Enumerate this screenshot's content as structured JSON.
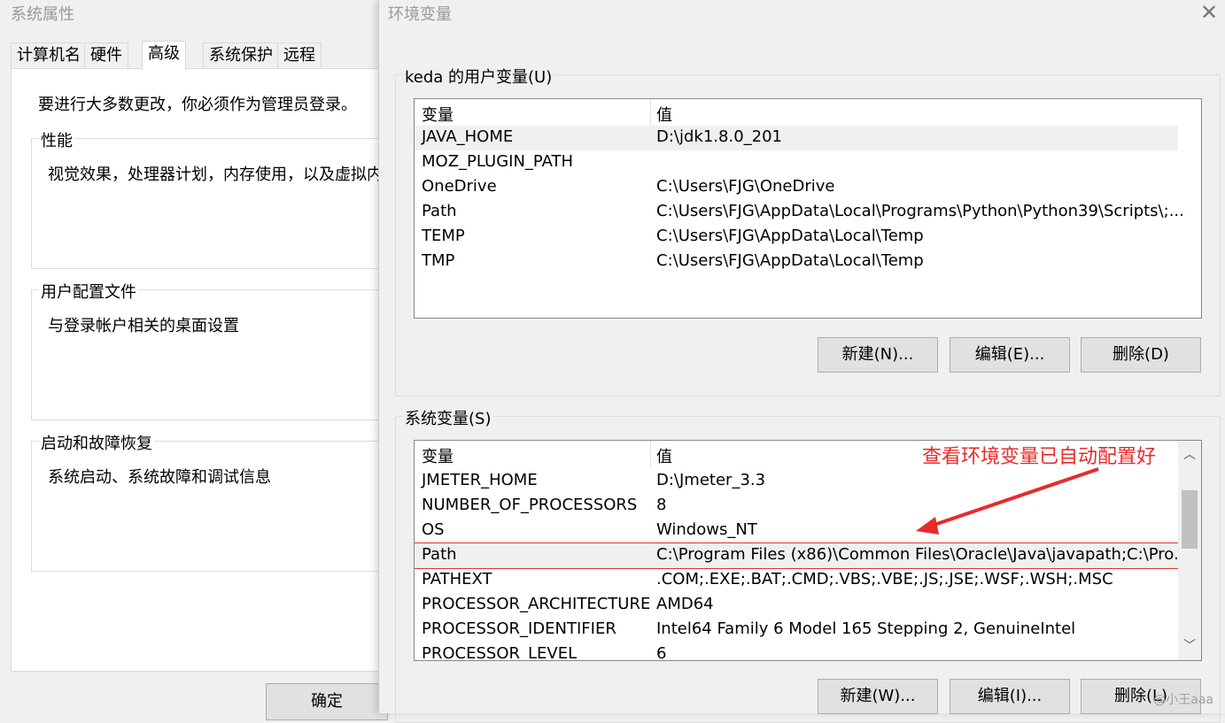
{
  "system_properties": {
    "title": "系统属性",
    "tabs": [
      "计算机名",
      "硬件",
      "高级",
      "系统保护",
      "远程"
    ],
    "active_tab": "高级",
    "admin_note": "要进行大多数更改，你必须作为管理员登录。",
    "groups": [
      {
        "label": "性能",
        "desc": "视觉效果，处理器计划，内存使用，以及虚拟内"
      },
      {
        "label": "用户配置文件",
        "desc": "与登录帐户相关的桌面设置"
      },
      {
        "label": "启动和故障恢复",
        "desc": "系统启动、系统故障和调试信息"
      }
    ],
    "ok_label": "确定"
  },
  "env_dialog": {
    "title": "环境变量",
    "close_icon": "close-icon",
    "user_vars": {
      "legend": "keda 的用户变量(U)",
      "col_var": "变量",
      "col_val": "值",
      "rows": [
        {
          "name": "JAVA_HOME",
          "value": "D:\\jdk1.8.0_201"
        },
        {
          "name": "MOZ_PLUGIN_PATH",
          "value": ""
        },
        {
          "name": "OneDrive",
          "value": "C:\\Users\\FJG\\OneDrive"
        },
        {
          "name": "Path",
          "value": "C:\\Users\\FJG\\AppData\\Local\\Programs\\Python\\Python39\\Scripts\\;..."
        },
        {
          "name": "TEMP",
          "value": "C:\\Users\\FJG\\AppData\\Local\\Temp"
        },
        {
          "name": "TMP",
          "value": "C:\\Users\\FJG\\AppData\\Local\\Temp"
        }
      ],
      "buttons": {
        "new": "新建(N)...",
        "edit": "编辑(E)...",
        "delete": "删除(D)"
      }
    },
    "sys_vars": {
      "legend": "系统变量(S)",
      "col_var": "变量",
      "col_val": "值",
      "rows": [
        {
          "name": "JMETER_HOME",
          "value": "D:\\Jmeter_3.3"
        },
        {
          "name": "NUMBER_OF_PROCESSORS",
          "value": "8"
        },
        {
          "name": "OS",
          "value": "Windows_NT"
        },
        {
          "name": "Path",
          "value": "C:\\Program Files (x86)\\Common Files\\Oracle\\Java\\javapath;C:\\Pro..."
        },
        {
          "name": "PATHEXT",
          "value": ".COM;.EXE;.BAT;.CMD;.VBS;.VBE;.JS;.JSE;.WSF;.WSH;.MSC"
        },
        {
          "name": "PROCESSOR_ARCHITECTURE",
          "value": "AMD64"
        },
        {
          "name": "PROCESSOR_IDENTIFIER",
          "value": "Intel64 Family 6 Model 165 Stepping 2, GenuineIntel"
        },
        {
          "name": "PROCESSOR_LEVEL",
          "value": "6"
        }
      ],
      "buttons": {
        "new": "新建(W)...",
        "edit": "编辑(I)...",
        "delete": "删除(L)"
      }
    },
    "annotation": "查看环境变量已自动配置好",
    "annotation_color": "#e62b2b",
    "watermark": "@小王aaa"
  }
}
